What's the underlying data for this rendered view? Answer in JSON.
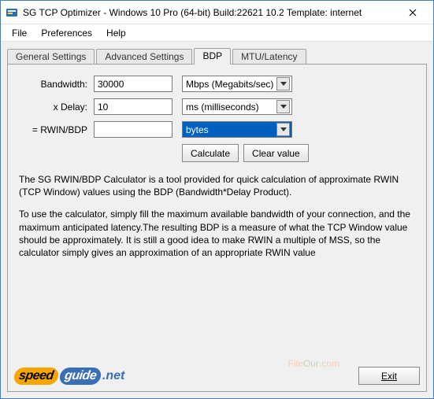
{
  "window": {
    "title": "SG TCP Optimizer - Windows 10 Pro (64-bit) Build:22621 10.2  Template: internet"
  },
  "menu": {
    "file": "File",
    "preferences": "Preferences",
    "help": "Help"
  },
  "tabs": {
    "general": "General Settings",
    "advanced": "Advanced Settings",
    "bdp": "BDP",
    "mtu": "MTU/Latency"
  },
  "form": {
    "bandwidth_label": "Bandwidth:",
    "bandwidth_value": "30000",
    "bandwidth_unit": "Mbps (Megabits/sec)",
    "delay_label": "x Delay:",
    "delay_value": "10",
    "delay_unit": "ms (milliseconds)",
    "rwin_label": "= RWIN/BDP",
    "rwin_value": "",
    "rwin_unit": "bytes"
  },
  "buttons": {
    "calculate": "Calculate",
    "clear": "Clear value",
    "exit": "Exit"
  },
  "description": {
    "p1": "The SG RWIN/BDP Calculator is a tool provided for quick calculation of approximate RWIN (TCP Window) values using the BDP (Bandwidth*Delay Product).",
    "p2": "To use the calculator, simply fill the maximum available bandwidth of your connection, and the maximum anticipated latency.The resulting BDP is a measure of what the TCP Window value should be approximately. It is still a good idea to make RWIN a multiple of MSS, so the calculator simply gives an approximation of an appropriate RWIN value"
  },
  "branding": {
    "logo1": "speed",
    "logo2": "guide",
    "logo3": ".net",
    "watermark1": "File",
    "watermark2": "Our",
    "watermark3": ".com"
  }
}
